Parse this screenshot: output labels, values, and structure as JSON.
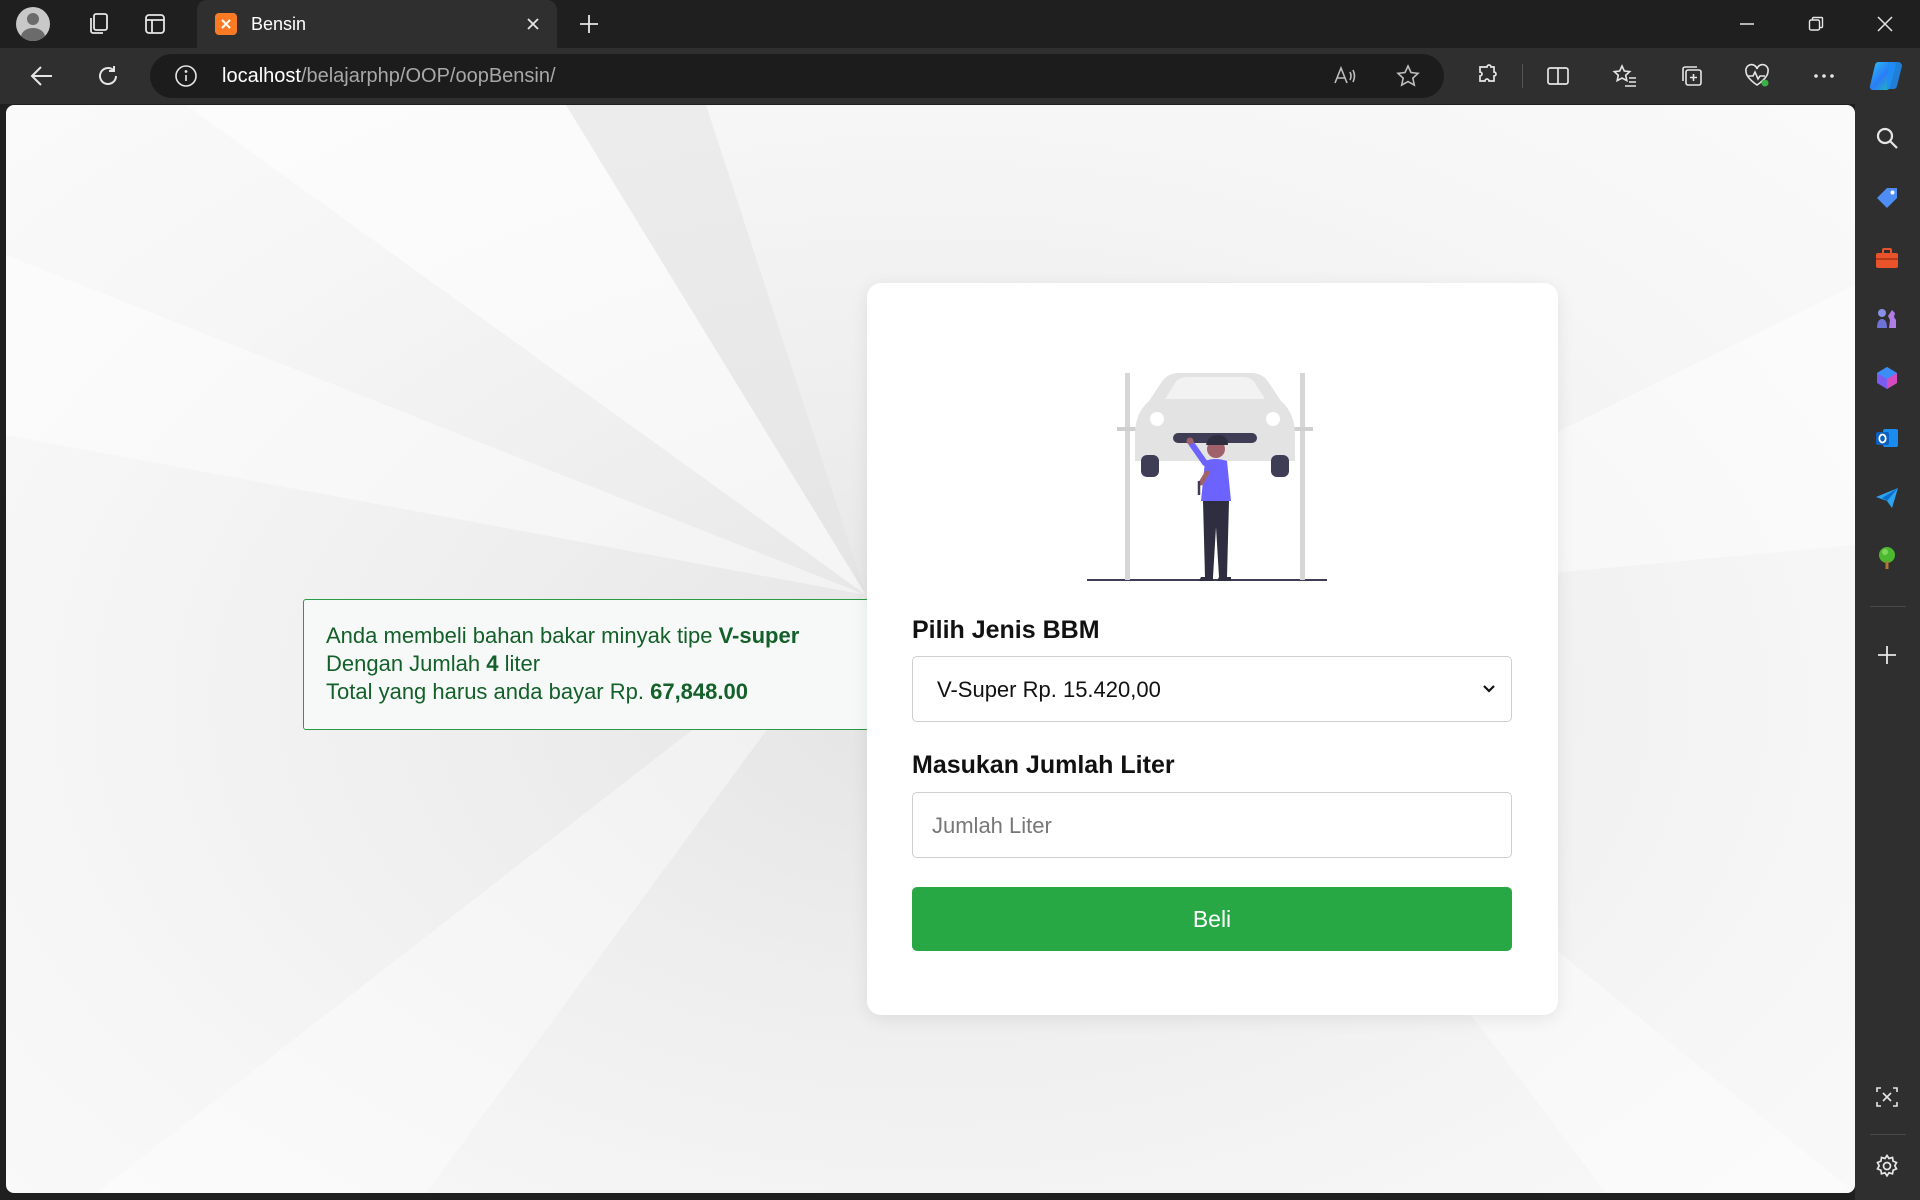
{
  "browser": {
    "tab": {
      "title": "Bensin",
      "favicon_letter": "ⴵ"
    },
    "url": {
      "host": "localhost",
      "path": "/belajarphp/OOP/oopBensin/"
    }
  },
  "result": {
    "line1_prefix": "Anda membeli bahan bakar minyak tipe ",
    "fuel_type": "V-super",
    "line2_prefix": "Dengan Jumlah ",
    "liters": "4",
    "line2_suffix": " liter",
    "line3_prefix": "Total yang harus anda bayar Rp. ",
    "total": "67,848.00"
  },
  "form": {
    "fuel_label": "Pilih Jenis BBM",
    "fuel_selected": "V-Super Rp. 15.420,00",
    "liters_label": "Masukan Jumlah Liter",
    "liters_placeholder": "Jumlah Liter",
    "submit_label": "Beli"
  },
  "colors": {
    "accent_green": "#28a745",
    "result_text": "#14602a",
    "illustration_purple": "#6c63ff"
  }
}
